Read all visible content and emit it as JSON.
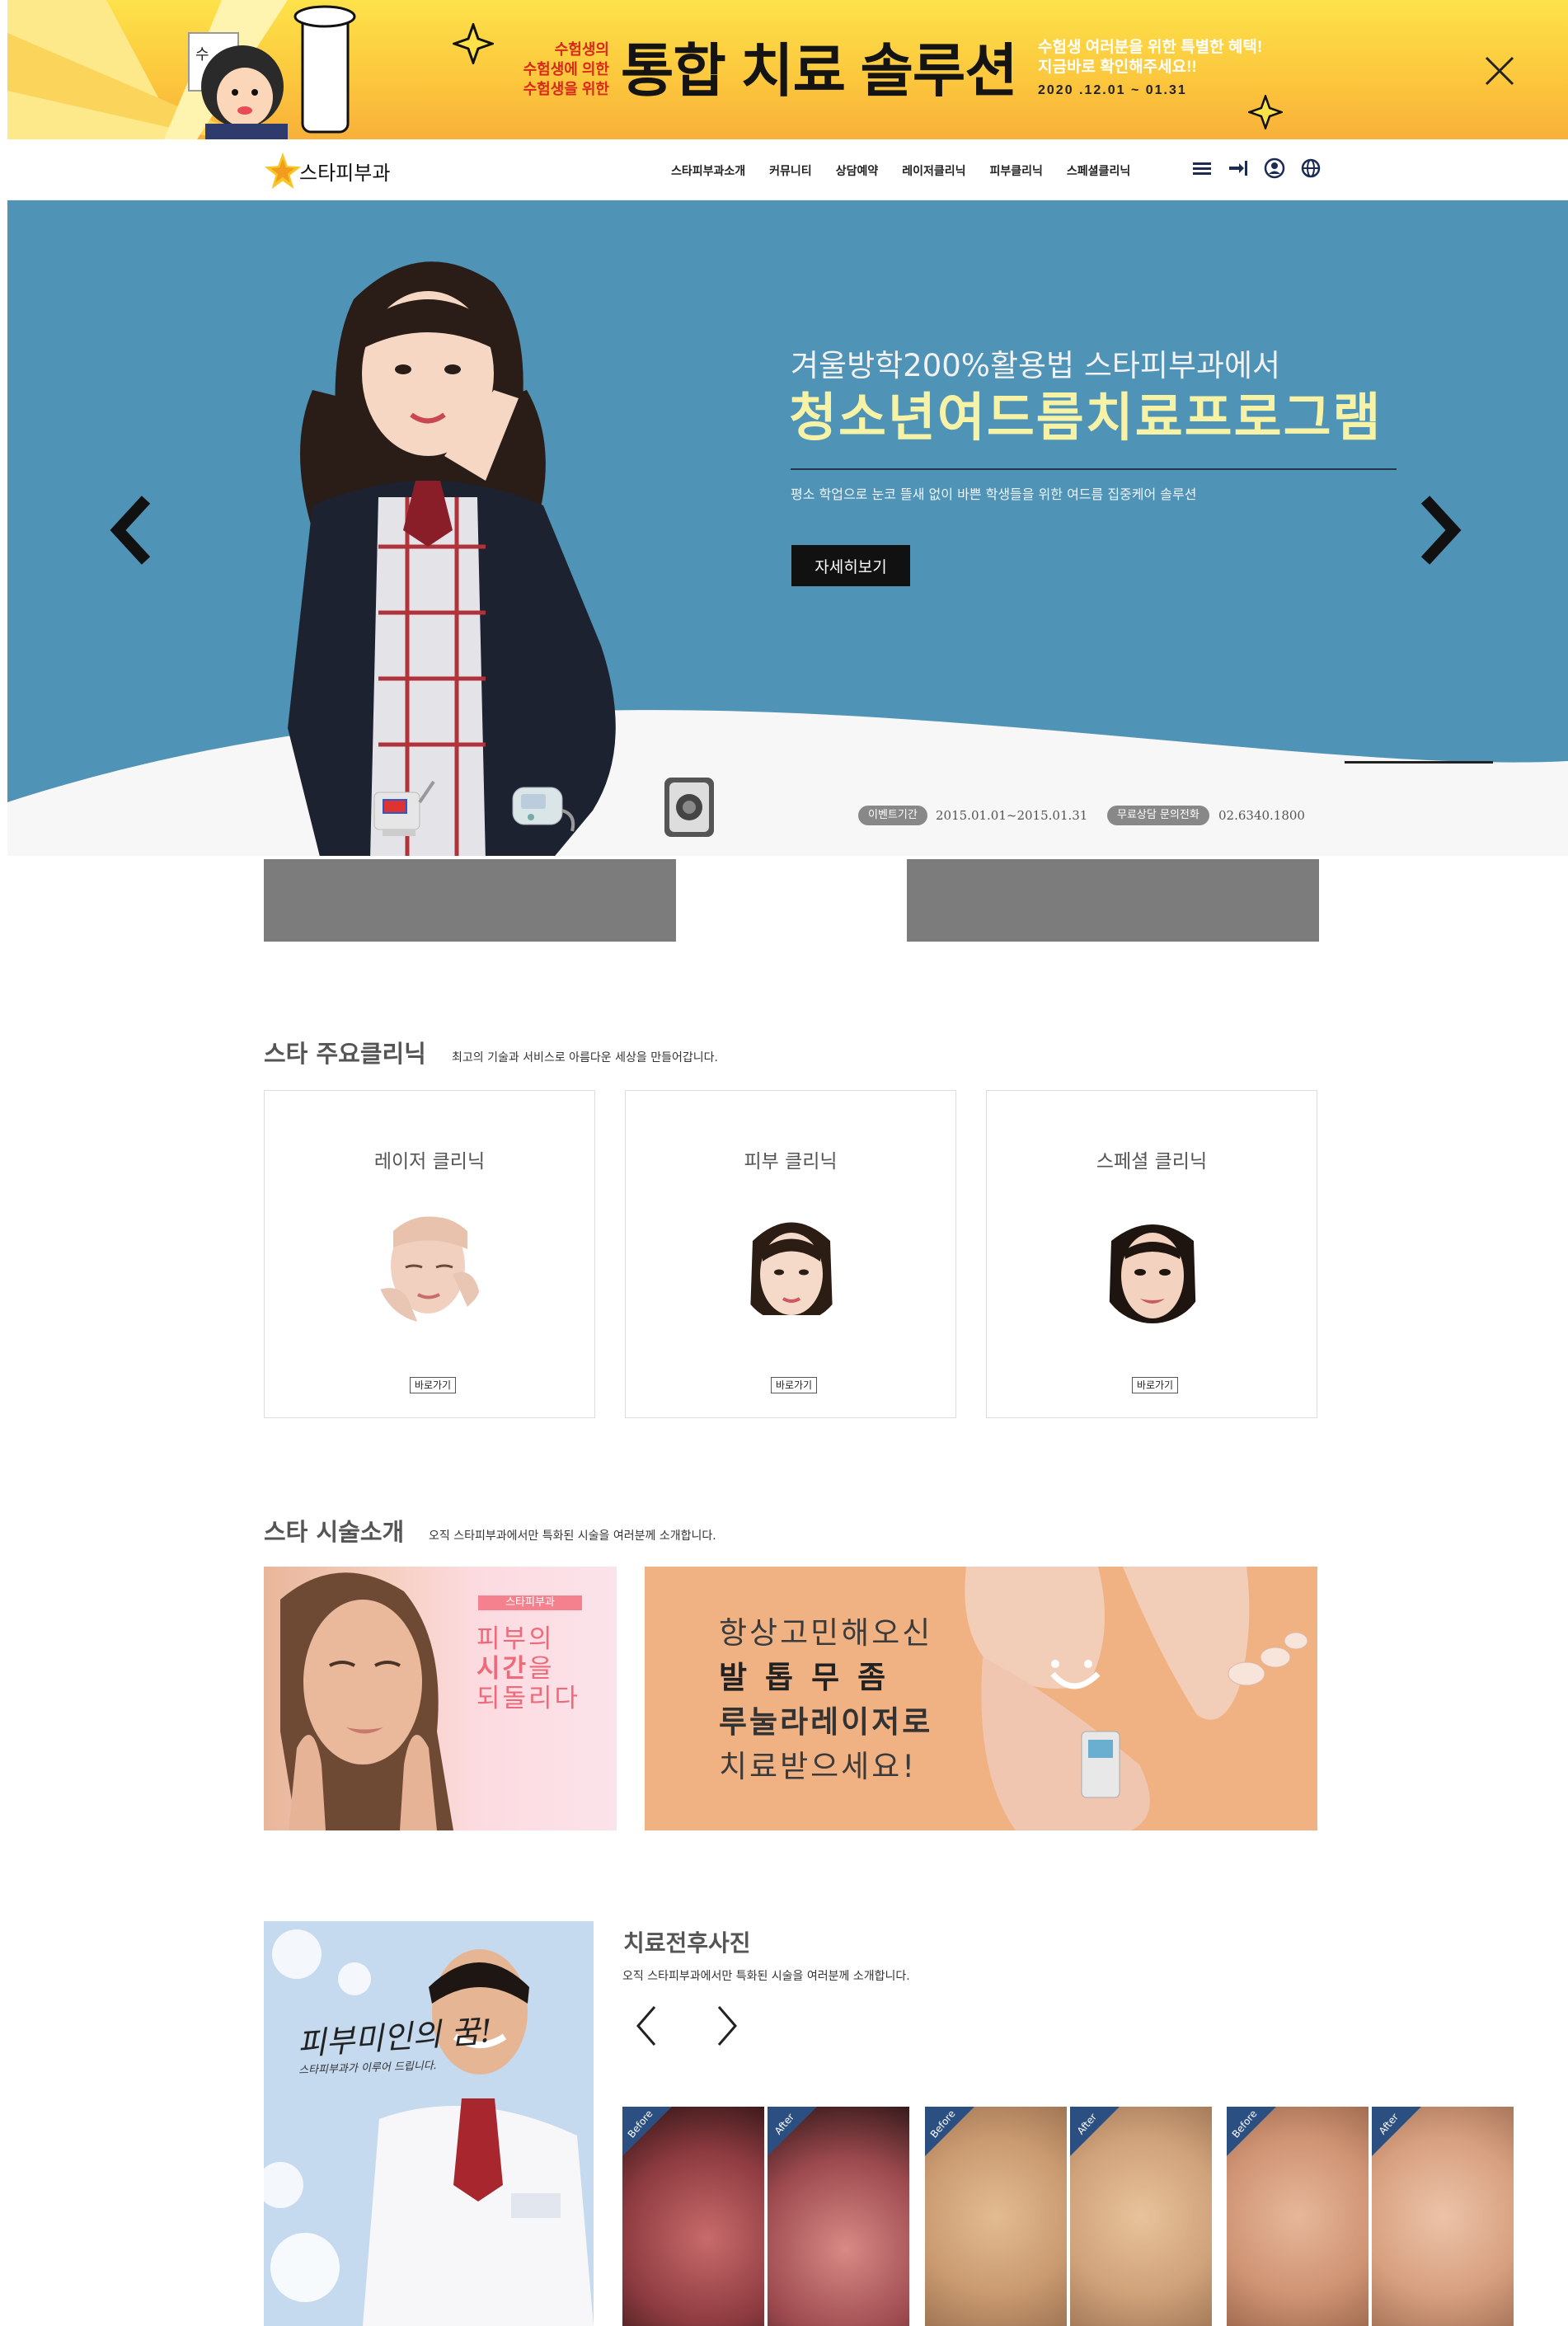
{
  "promo": {
    "left_lines": [
      "수험생의",
      "수험생에 의한",
      "수험생을 위한"
    ],
    "title": "통합 치료 솔루션",
    "right_line1": "수험생 여러분을 위한 특별한 혜택!",
    "right_line2": "지금바로 확인해주세요!!",
    "date": "2020 .12.01  ~  01.31",
    "colors": {
      "bg_top": "#fde24a",
      "bg_bottom": "#f8b03a",
      "accent_red": "#d8291b"
    }
  },
  "header": {
    "logo_text": "스타피부과",
    "nav": [
      "스타피부과소개",
      "커뮤니티",
      "상담예약",
      "레이저클리닉",
      "피부클리닉",
      "스페셜클리닉"
    ],
    "util_icons": [
      "menu-icon",
      "login-icon",
      "user-icon",
      "globe-icon"
    ]
  },
  "hero": {
    "subtitle": "겨울방학200%활용법 스타피부과에서",
    "headline": "청소년여드름치료프로그램",
    "description": "평소 학업으로 눈코 뜰새 없이 바쁜 학생들을 위한 여드름 집중케어 솔루션",
    "button": "자세히보기",
    "event_label": "이벤트기간",
    "event_period": "2015.01.01~2015.01.31",
    "consult_label": "무료상담 문의전화",
    "phone": "02.6340.1800",
    "colors": {
      "bg": "#4f93b7",
      "headline": "#f6f3a7"
    }
  },
  "clinics": {
    "title": "스타 주요클리닉",
    "subtitle": "최고의 기술과 서비스로 아름다운 세상을 만들어갑니다.",
    "items": [
      {
        "title": "레이저 클리닉",
        "button": "바로가기"
      },
      {
        "title": "피부 클리닉",
        "button": "바로가기"
      },
      {
        "title": "스페셜 클리닉",
        "button": "바로가기"
      }
    ]
  },
  "treatments": {
    "title": "스타 시술소개",
    "subtitle": "오직 스타피부과에서만 특화된 시술을 여러분께 소개합니다.",
    "banner1": {
      "tag": "스타피부과",
      "line1": "피부의",
      "line2_em": "시간",
      "line2_rest": "을",
      "line3": "되돌리다"
    },
    "banner2": {
      "line1": "항상고민해오신",
      "line2": "발톱무좀",
      "line3": "루눌라레이저로",
      "line4": "치료받으세요!"
    }
  },
  "before_after": {
    "doctor_slogan": "피부미인의 꿈!",
    "doctor_slogan_sub": "스타피부과가 이루어 드립니다.",
    "title": "치료전후사진",
    "subtitle": "오직 스타피부과에서만 특화된 시술을 여러분께 소개합니다.",
    "before_label": "Before",
    "after_label": "After",
    "cards": 3
  }
}
